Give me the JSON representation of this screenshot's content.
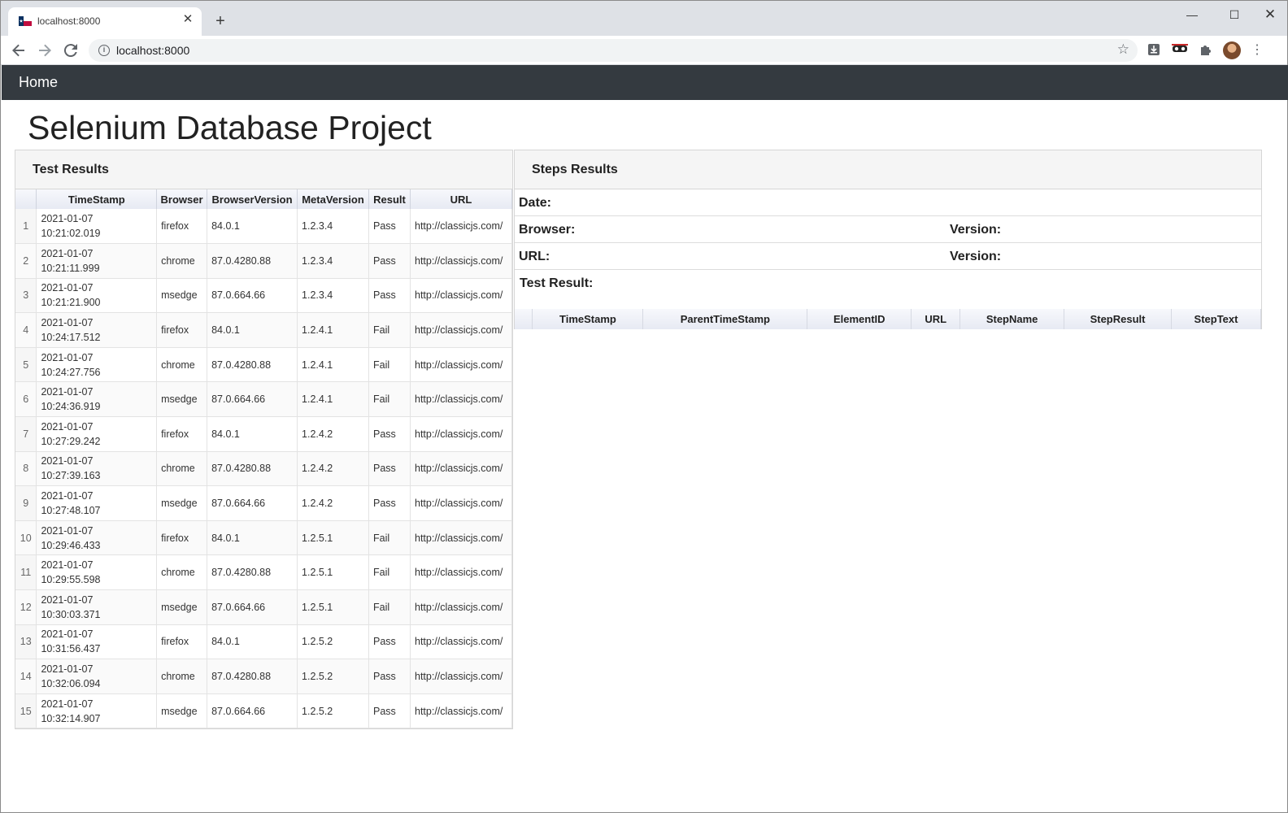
{
  "browser": {
    "tab_title": "localhost:8000",
    "tab_close": "✕",
    "new_tab": "+",
    "address": "localhost:8000",
    "minimize": "—",
    "maximize": "☐",
    "close": "✕"
  },
  "navbar": {
    "home_label": "Home"
  },
  "page": {
    "title": "Selenium Database Project"
  },
  "test_results": {
    "heading": "Test Results",
    "columns": [
      "",
      "TimeStamp",
      "Browser",
      "BrowserVersion",
      "MetaVersion",
      "Result",
      "URL"
    ],
    "rows": [
      {
        "n": "1",
        "date": "2021-01-07",
        "time": "10:21:02.019",
        "browser": "firefox",
        "bver": "84.0.1",
        "meta": "1.2.3.4",
        "result": "Pass",
        "url": "http://classicjs.com/"
      },
      {
        "n": "2",
        "date": "2021-01-07",
        "time": "10:21:11.999",
        "browser": "chrome",
        "bver": "87.0.4280.88",
        "meta": "1.2.3.4",
        "result": "Pass",
        "url": "http://classicjs.com/"
      },
      {
        "n": "3",
        "date": "2021-01-07",
        "time": "10:21:21.900",
        "browser": "msedge",
        "bver": "87.0.664.66",
        "meta": "1.2.3.4",
        "result": "Pass",
        "url": "http://classicjs.com/"
      },
      {
        "n": "4",
        "date": "2021-01-07",
        "time": "10:24:17.512",
        "browser": "firefox",
        "bver": "84.0.1",
        "meta": "1.2.4.1",
        "result": "Fail",
        "url": "http://classicjs.com/"
      },
      {
        "n": "5",
        "date": "2021-01-07",
        "time": "10:24:27.756",
        "browser": "chrome",
        "bver": "87.0.4280.88",
        "meta": "1.2.4.1",
        "result": "Fail",
        "url": "http://classicjs.com/"
      },
      {
        "n": "6",
        "date": "2021-01-07",
        "time": "10:24:36.919",
        "browser": "msedge",
        "bver": "87.0.664.66",
        "meta": "1.2.4.1",
        "result": "Fail",
        "url": "http://classicjs.com/"
      },
      {
        "n": "7",
        "date": "2021-01-07",
        "time": "10:27:29.242",
        "browser": "firefox",
        "bver": "84.0.1",
        "meta": "1.2.4.2",
        "result": "Pass",
        "url": "http://classicjs.com/"
      },
      {
        "n": "8",
        "date": "2021-01-07",
        "time": "10:27:39.163",
        "browser": "chrome",
        "bver": "87.0.4280.88",
        "meta": "1.2.4.2",
        "result": "Pass",
        "url": "http://classicjs.com/"
      },
      {
        "n": "9",
        "date": "2021-01-07",
        "time": "10:27:48.107",
        "browser": "msedge",
        "bver": "87.0.664.66",
        "meta": "1.2.4.2",
        "result": "Pass",
        "url": "http://classicjs.com/"
      },
      {
        "n": "10",
        "date": "2021-01-07",
        "time": "10:29:46.433",
        "browser": "firefox",
        "bver": "84.0.1",
        "meta": "1.2.5.1",
        "result": "Fail",
        "url": "http://classicjs.com/"
      },
      {
        "n": "11",
        "date": "2021-01-07",
        "time": "10:29:55.598",
        "browser": "chrome",
        "bver": "87.0.4280.88",
        "meta": "1.2.5.1",
        "result": "Fail",
        "url": "http://classicjs.com/"
      },
      {
        "n": "12",
        "date": "2021-01-07",
        "time": "10:30:03.371",
        "browser": "msedge",
        "bver": "87.0.664.66",
        "meta": "1.2.5.1",
        "result": "Fail",
        "url": "http://classicjs.com/"
      },
      {
        "n": "13",
        "date": "2021-01-07",
        "time": "10:31:56.437",
        "browser": "firefox",
        "bver": "84.0.1",
        "meta": "1.2.5.2",
        "result": "Pass",
        "url": "http://classicjs.com/"
      },
      {
        "n": "14",
        "date": "2021-01-07",
        "time": "10:32:06.094",
        "browser": "chrome",
        "bver": "87.0.4280.88",
        "meta": "1.2.5.2",
        "result": "Pass",
        "url": "http://classicjs.com/"
      },
      {
        "n": "15",
        "date": "2021-01-07",
        "time": "10:32:14.907",
        "browser": "msedge",
        "bver": "87.0.664.66",
        "meta": "1.2.5.2",
        "result": "Pass",
        "url": "http://classicjs.com/"
      }
    ]
  },
  "steps_results": {
    "heading": "Steps Results",
    "date_label": "Date:",
    "browser_label": "Browser:",
    "version_label_1": "Version:",
    "url_label": "URL:",
    "version_label_2": "Version:",
    "test_result_label": "Test Result:",
    "columns": [
      "",
      "TimeStamp",
      "ParentTimeStamp",
      "ElementID",
      "URL",
      "StepName",
      "StepResult",
      "StepText"
    ]
  },
  "colors": {
    "navbar": "#343a40",
    "tabstrip": "#dee1e6",
    "panel_heading": "#f5f5f5"
  },
  "icons": [
    "back-arrow-icon",
    "forward-arrow-icon",
    "reload-icon",
    "info-icon",
    "star-icon",
    "download-icon",
    "mask-icon",
    "puzzle-icon",
    "menu-dots-icon"
  ]
}
